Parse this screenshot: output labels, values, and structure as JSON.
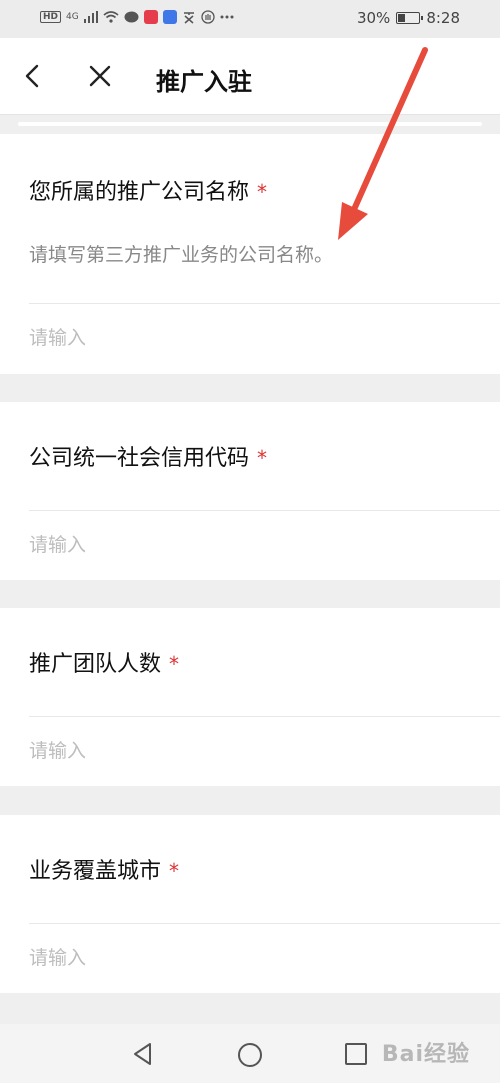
{
  "status_bar": {
    "left_badges": [
      "HD",
      "4G"
    ],
    "battery": "30%",
    "time": "8:28",
    "icons": [
      "signal-icon",
      "wifi-icon",
      "chat-icon",
      "app-red-icon",
      "app-blue-icon",
      "text-icon",
      "hand-icon",
      "more-icon",
      "battery-icon"
    ]
  },
  "nav": {
    "title": "推广入驻",
    "back_icon": "chevron-left-icon",
    "close_icon": "close-icon"
  },
  "form": {
    "fields": [
      {
        "label": "您所属的推广公司名称",
        "required_mark": "*",
        "description": "请填写第三方推广业务的公司名称。",
        "placeholder": "请输入"
      },
      {
        "label": "公司统一社会信用代码",
        "required_mark": "*",
        "placeholder": "请输入"
      },
      {
        "label": "推广团队人数",
        "required_mark": "*",
        "placeholder": "请输入"
      },
      {
        "label": "业务覆盖城市",
        "required_mark": "*",
        "placeholder": "请输入"
      }
    ]
  },
  "bottom_nav": {
    "icons": [
      "triangle-back-icon",
      "circle-home-icon",
      "square-recent-icon"
    ]
  },
  "watermark": {
    "text": "Bai经验"
  },
  "colors": {
    "required": "#dd3333",
    "arrow": "#e64b3c",
    "placeholder": "#bdbdbd",
    "background": "#efefef"
  }
}
